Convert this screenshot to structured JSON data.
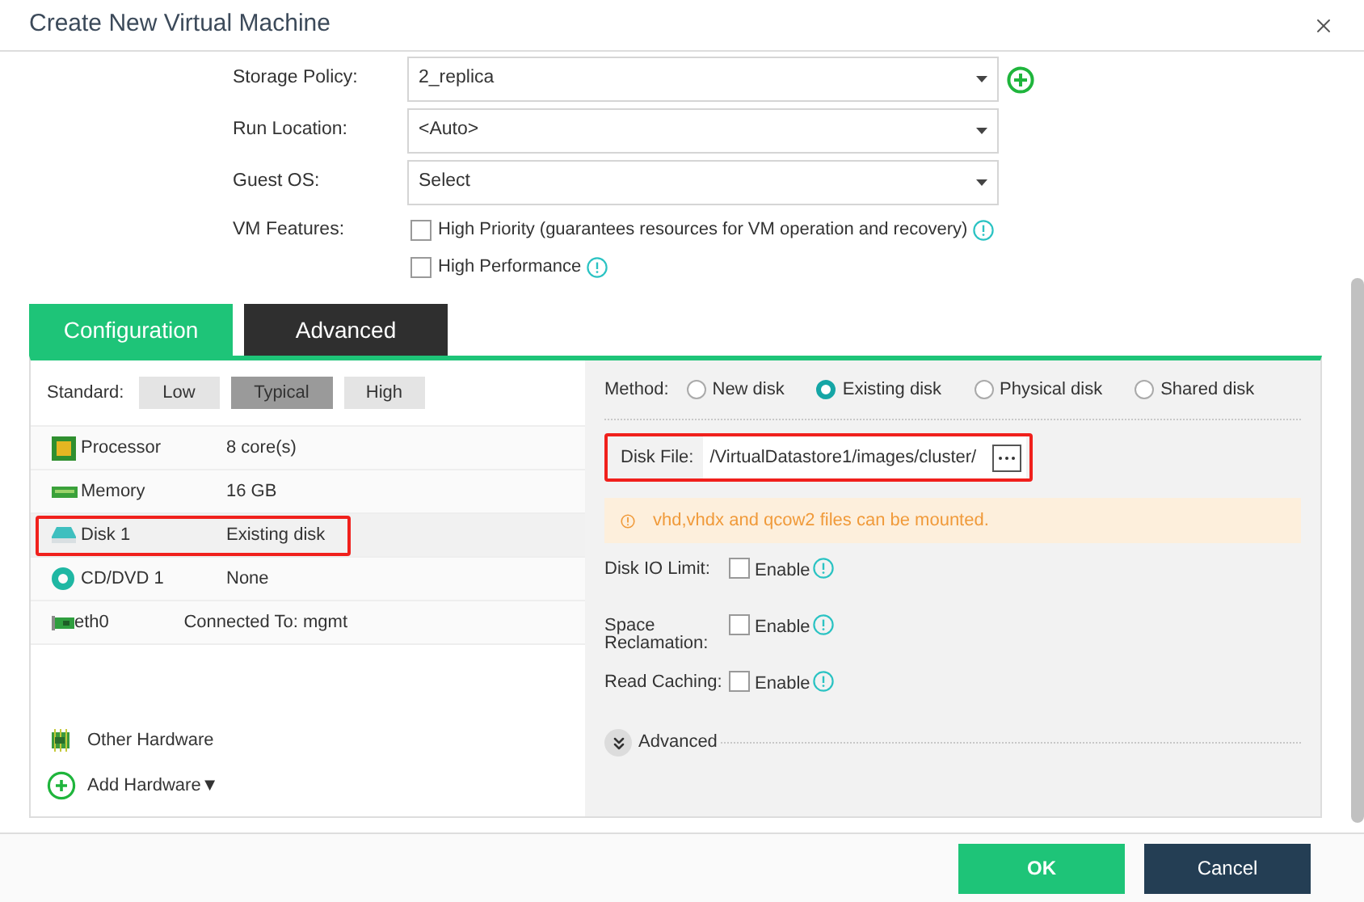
{
  "window": {
    "title": "Create New Virtual Machine"
  },
  "form": [
    {
      "label": "Storage Policy:",
      "value": "2_replica",
      "add_button": true
    },
    {
      "label": "Run Location:",
      "value": "<Auto>",
      "add_button": false
    },
    {
      "label": "Guest OS:",
      "value": "Select",
      "add_button": false
    }
  ],
  "vm_features": {
    "label": "VM Features:",
    "options": [
      {
        "label": "High Priority",
        "note": "(guarantees resources for VM operation and recovery)",
        "checked": false
      },
      {
        "label": "High Performance",
        "checked": false
      }
    ]
  },
  "tabs": [
    {
      "label": "Configuration",
      "selected": true
    },
    {
      "label": "Advanced",
      "selected": false
    }
  ],
  "standard": {
    "label": "Standard:",
    "options": [
      {
        "label": "Low",
        "selected": false
      },
      {
        "label": "Typical",
        "selected": true
      },
      {
        "label": "High",
        "selected": false
      }
    ]
  },
  "hardware": [
    {
      "kind": "processor",
      "name": "Processor",
      "value": "8 core(s)",
      "highlighted": false
    },
    {
      "kind": "memory",
      "name": "Memory",
      "value": "16 GB",
      "highlighted": false
    },
    {
      "kind": "disk",
      "name": "Disk 1",
      "value": "Existing disk",
      "highlighted": true
    },
    {
      "kind": "cdrom",
      "name": "CD/DVD 1",
      "value": "None",
      "highlighted": false
    },
    {
      "kind": "nic",
      "name": "eth0",
      "value": "Connected To: mgmt",
      "highlighted": false
    }
  ],
  "other_hardware": "Other Hardware",
  "add_hardware": "Add Hardware▼",
  "disk": {
    "method_label": "Method:",
    "methods": [
      {
        "label": "New disk",
        "selected": false
      },
      {
        "label": "Existing disk",
        "selected": true
      },
      {
        "label": "Physical disk",
        "selected": false
      },
      {
        "label": "Shared disk",
        "selected": false
      }
    ],
    "disk_file": {
      "label": "Disk File:",
      "value": "/VirtualDatastore1/images/cluster/",
      "highlighted": true
    },
    "notice": "vhd,vhdx and qcow2 files can be mounted.",
    "options": [
      {
        "label": "Disk IO Limit:",
        "enable": "Enable",
        "checked": false
      },
      {
        "label": "Space Reclamation:",
        "enable": "Enable",
        "checked": false
      },
      {
        "label": "Read Caching:",
        "enable": "Enable",
        "checked": false
      }
    ],
    "advanced": "Advanced"
  },
  "buttons": [
    {
      "kind": "primary",
      "label": "OK"
    },
    {
      "kind": "secondary",
      "label": "Cancel"
    }
  ]
}
